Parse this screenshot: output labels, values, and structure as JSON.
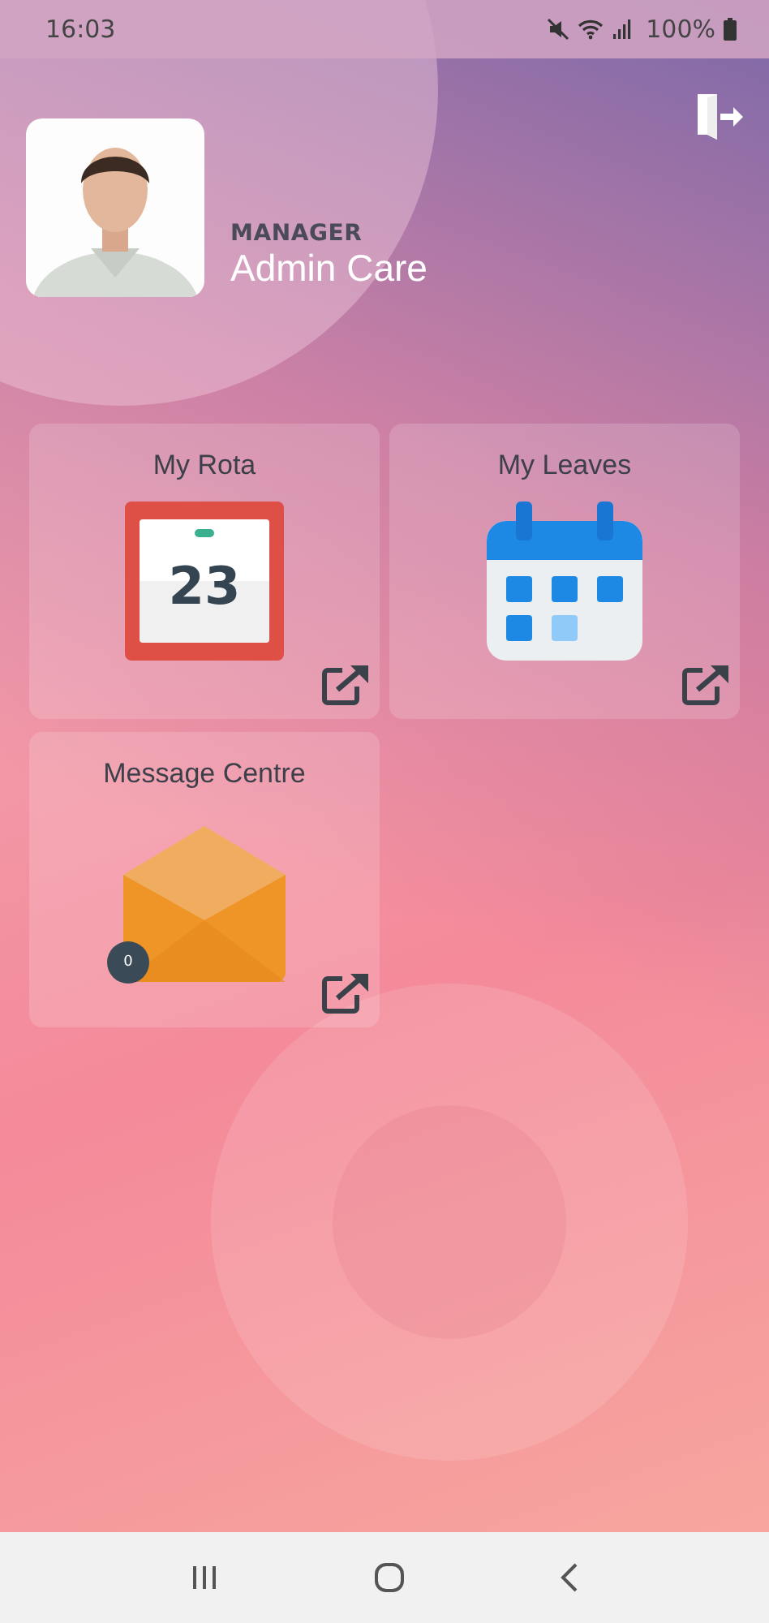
{
  "status_bar": {
    "time": "16:03",
    "battery": "100%"
  },
  "profile": {
    "role": "MANAGER",
    "name": "Admin Care"
  },
  "tiles": [
    {
      "kind": "rota",
      "title": "My Rota",
      "date": "23"
    },
    {
      "kind": "leaves",
      "title": "My Leaves"
    },
    {
      "kind": "messages",
      "title": "Message Centre",
      "badge": "0"
    }
  ]
}
